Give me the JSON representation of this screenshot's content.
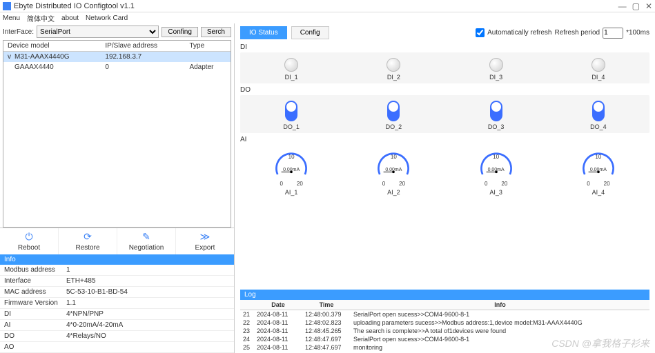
{
  "app": {
    "title": "Ebyte Distributed IO Configtool v1.1"
  },
  "menu": {
    "items": [
      "Menu",
      "简体中文",
      "about",
      "Network Card"
    ]
  },
  "left": {
    "interface_label": "InterFace:",
    "interface_value": "SerialPort",
    "confing": "Confing",
    "serch": "Serch",
    "cols": {
      "model": "Device model",
      "addr": "IP/Slave address",
      "type": "Type"
    },
    "rows": [
      {
        "model": "M31-AAAX4440G",
        "addr": "192.168.3.7",
        "type": "",
        "sel": true,
        "exp": "v"
      },
      {
        "model": "GAAAX4440",
        "addr": "0",
        "type": "Adapter",
        "sel": false,
        "exp": ""
      }
    ],
    "actions": {
      "reboot": "Reboot",
      "restore": "Restore",
      "negotiation": "Negotiation",
      "export": "Export"
    }
  },
  "info": {
    "title": "Info",
    "rows": [
      [
        "Modbus address",
        "1"
      ],
      [
        "Interface",
        "ETH+485"
      ],
      [
        "MAC address",
        "5C-53-10-B1-BD-54"
      ],
      [
        "Firmware Version",
        "1.1"
      ],
      [
        "DI",
        "4*NPN/PNP"
      ],
      [
        "AI",
        "4*0-20mA/4-20mA"
      ],
      [
        "DO",
        "4*Relays/NO"
      ],
      [
        "AO",
        ""
      ]
    ]
  },
  "right": {
    "tabs": {
      "io": "IO Status",
      "config": "Config"
    },
    "autorefresh_label": "Automatically refresh",
    "period_label": "Refresh period",
    "period_value": "1",
    "period_suffix": "*100ms",
    "di": {
      "label": "DI",
      "items": [
        "DI_1",
        "DI_2",
        "DI_3",
        "DI_4"
      ]
    },
    "do": {
      "label": "DO",
      "items": [
        "DO_1",
        "DO_2",
        "DO_3",
        "DO_4"
      ]
    },
    "ai": {
      "label": "AI",
      "items": [
        "AI_1",
        "AI_2",
        "AI_3",
        "AI_4"
      ],
      "value": "0.00mA",
      "lo": "0",
      "mid": "10",
      "hi": "20"
    }
  },
  "log": {
    "title": "Log",
    "cols": {
      "date": "Date",
      "time": "Time",
      "info": "Info"
    },
    "rows": [
      [
        "21",
        "2024-08-11",
        "12:48:00.379",
        "SerialPort open sucess>>COM4-9600-8-1"
      ],
      [
        "22",
        "2024-08-11",
        "12:48:02.823",
        "uploading parameters sucess>>Modbus address:1,device model:M31-AAAX4440G"
      ],
      [
        "23",
        "2024-08-11",
        "12:48:45.265",
        "The search is complete>>A total of1devices were found"
      ],
      [
        "24",
        "2024-08-11",
        "12:48:47.697",
        "SerialPort open sucess>>COM4-9600-8-1"
      ],
      [
        "25",
        "2024-08-11",
        "12:48:47.697",
        "monitoring"
      ]
    ]
  },
  "watermark": "CSDN @拿我格子衫来"
}
